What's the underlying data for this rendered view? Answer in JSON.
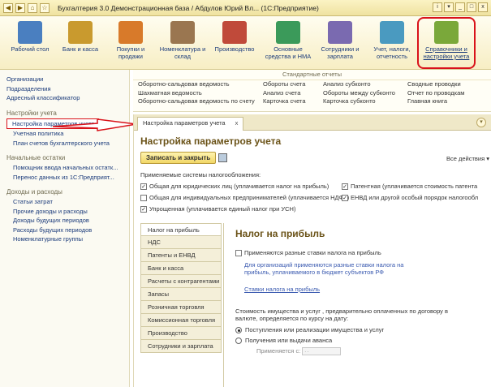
{
  "window": {
    "title": "Бухгалтерия 3.0 Демонстрационная база / Абдулов Юрий Вл... (1С:Предприятие)",
    "sys_icons": [
      "◀",
      "▶",
      "⌂",
      "☆"
    ],
    "win_buttons": [
      "i",
      "▾",
      "_",
      "□",
      "x"
    ]
  },
  "toolbar": {
    "items": [
      {
        "label": "Рабочий стол",
        "icon": "desktop-icon",
        "color": "#4a7fc0"
      },
      {
        "label": "Банк и касса",
        "icon": "bank-icon",
        "color": "#c99a2e"
      },
      {
        "label": "Покупки и продажи",
        "icon": "cart-icon",
        "color": "#d87a2a"
      },
      {
        "label": "Номенклатура и склад",
        "icon": "warehouse-icon",
        "color": "#9a7650"
      },
      {
        "label": "Производство",
        "icon": "factory-icon",
        "color": "#c04a3a"
      },
      {
        "label": "Основные средства и НМА",
        "icon": "assets-icon",
        "color": "#3b9a5a"
      },
      {
        "label": "Сотрудники и зарплата",
        "icon": "staff-icon",
        "color": "#7a6ab0"
      },
      {
        "label": "Учет, налоги, отчетность",
        "icon": "reports-icon",
        "color": "#4a9ac0"
      },
      {
        "label": "Справочники и настройки учета",
        "icon": "books-icon",
        "color": "#7aa83a"
      }
    ]
  },
  "sidebar": {
    "top_items": [
      "Организации",
      "Подразделения",
      "Адресный классификатор"
    ],
    "groups": [
      {
        "title": "Настройки учета",
        "items": [
          "Настройка параметров учета",
          "Учетная политика",
          "План счетов бухгалтерского учета"
        ]
      },
      {
        "title": "Начальные остатки",
        "items": [
          "Помощник ввода начальных остатк...",
          "Перенос данных из 1С:Предприят..."
        ]
      },
      {
        "title": "Доходы и расходы",
        "items": [
          "Статьи затрат",
          "Прочие доходы и расходы",
          "Доходы будущих периодов",
          "Расходы будущих периодов",
          "Номенклатурные группы"
        ]
      }
    ]
  },
  "reports": {
    "header": "Стандартные отчеты",
    "columns": [
      [
        "Оборотно-сальдовая ведомость",
        "Шахматная ведомость",
        "Оборотно-сальдовая ведомость по счету"
      ],
      [
        "Обороты счета",
        "Анализ счета",
        "Карточка счета"
      ],
      [
        "Анализ субконто",
        "Обороты между субконто",
        "Карточка субконто"
      ],
      [
        "Сводные проводки",
        "Отчет по проводкам",
        "Главная книга"
      ]
    ]
  },
  "content": {
    "tab_label": "Настройка параметров учета",
    "tab_close": "x",
    "title": "Настройка параметров учета",
    "save_button": "Записать и закрыть",
    "all_actions": "Все действия",
    "tax_systems_label": "Применяемые системы налогообложения:",
    "tax_checkboxes": [
      {
        "label": "Общая для юридических лиц (уплачивается налог на прибыль)",
        "checked": true
      },
      {
        "label": "Общая для индивидуальных предпринимателей (уплачивается НДФЛ)",
        "checked": false
      },
      {
        "label": "Упрощенная (уплачивается единый налог при УСН)",
        "checked": true
      },
      {
        "label": "Патентная (уплачивается стоимость патента",
        "checked": true
      },
      {
        "label": "ЕНВД или другой особый порядок налогообл",
        "checked": true
      }
    ],
    "side_tabs": [
      "Налог на прибыль",
      "НДС",
      "Патенты и ЕНВД",
      "Банк и касса",
      "Расчеты с контрагентами",
      "Запасы",
      "Розничная торговля",
      "Комиссионная торговля",
      "Производство",
      "Сотрудники и зарплата"
    ],
    "panel": {
      "title": "Налог на прибыль",
      "checkbox_label": "Применяются разные ставки налога на прибыль",
      "note": "Для организаций применяются разные ставки налога на прибыль, уплачиваемого в бюджет субъектов РФ",
      "rates_link": "Ставки налога на прибыль",
      "prepaid_text": "Стоимость имущества и услуг , предварительно оплаченных по договору в валюте, определяется по курсу на дату:",
      "radio_options": [
        {
          "label": "Поступления или реализации имущества и услуг",
          "selected": true
        },
        {
          "label": "Получения или выдачи аванса",
          "selected": false
        }
      ],
      "applied_from_label": "Применяется с:"
    }
  }
}
